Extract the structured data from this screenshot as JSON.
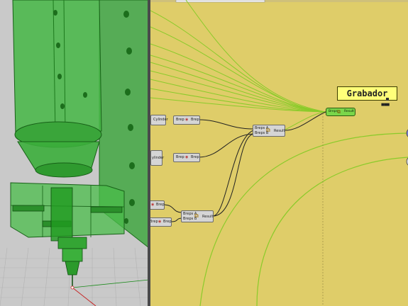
{
  "viewport": {
    "background": "#c9c9c9",
    "model_color": "#2fb02f",
    "grid_color": "#b5b5b5"
  },
  "canvas": {
    "background": "#dfcd69",
    "wire_color": "#8acb2a",
    "data_wire_color": "#222222",
    "group": {
      "title": "Grabador"
    },
    "components": [
      {
        "id": "cyl1",
        "in_label": "Cylinder",
        "out_label": "Brep",
        "mid_label": "Brep"
      },
      {
        "id": "cyl2",
        "in_label": "ylinder",
        "out_label": "Brep",
        "mid_label": "Brep"
      },
      {
        "id": "union1",
        "in_a": "Breps A",
        "in_b": "Breps B",
        "out": "Result"
      },
      {
        "id": "brep3",
        "label": "Brep"
      },
      {
        "id": "brep4",
        "label": "Brep"
      },
      {
        "id": "union2",
        "in_a": "Breps A",
        "in_b": "Breps B",
        "out": "Result"
      },
      {
        "id": "final",
        "in": "Breps",
        "out": "Result"
      }
    ]
  }
}
